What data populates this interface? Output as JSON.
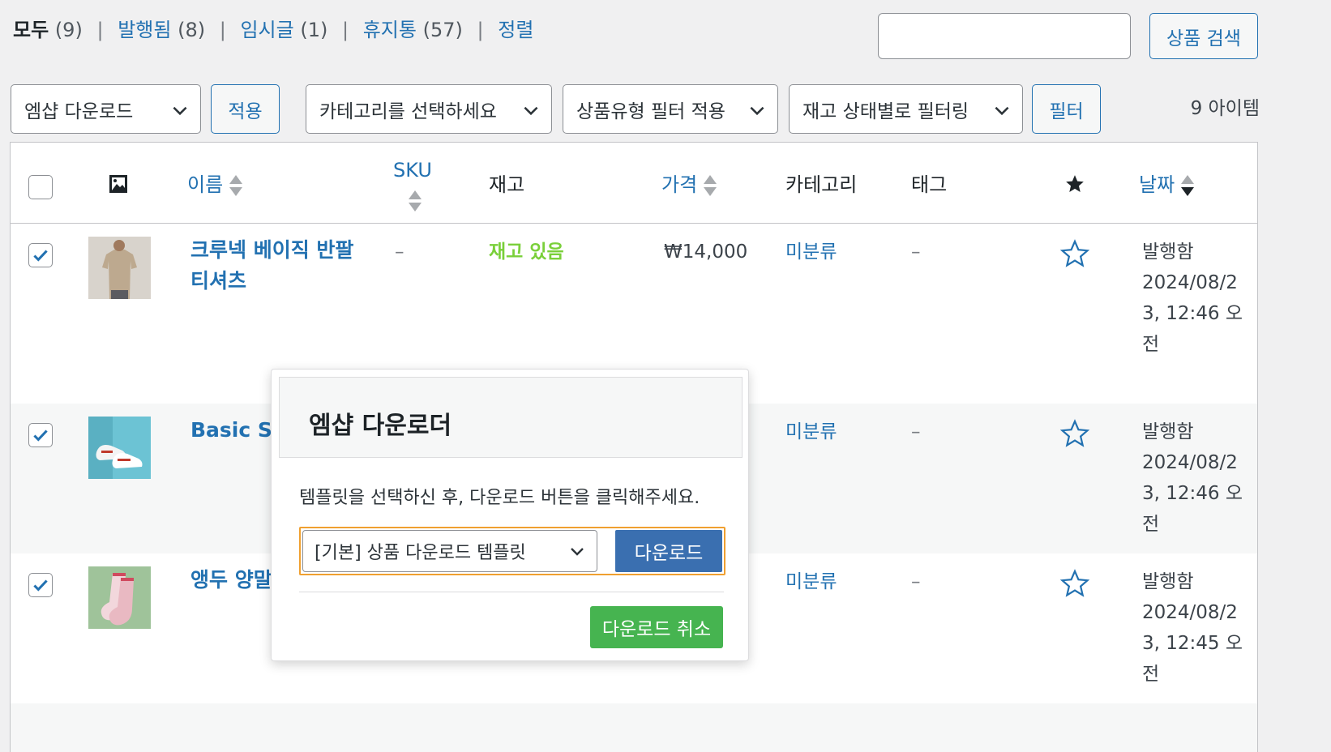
{
  "status_links": {
    "all": {
      "label": "모두",
      "count": "(9)"
    },
    "published": {
      "label": "발행됨",
      "count": "(8)"
    },
    "draft": {
      "label": "임시글",
      "count": "(1)"
    },
    "trash": {
      "label": "휴지통",
      "count": "(57)"
    },
    "sort": {
      "label": "정렬"
    },
    "separator": "|"
  },
  "search": {
    "placeholder": "",
    "button_label": "상품 검색"
  },
  "bulk_action": {
    "selected": "엠샵 다운로드",
    "apply_label": "적용"
  },
  "filters": {
    "category": "카테고리를 선택하세요",
    "product_type": "상품유형 필터 적용",
    "stock_status": "재고 상태별로 필터링",
    "filter_label": "필터"
  },
  "items_count": "9 아이템",
  "table": {
    "headers": {
      "name": "이름",
      "sku": "SKU",
      "stock": "재고",
      "price": "가격",
      "category": "카테고리",
      "tags": "태그",
      "date": "날짜"
    },
    "rows": [
      {
        "name_line1": "크루넥 베이직 반팔",
        "name_line2": "티셔츠",
        "sku": "–",
        "stock": "재고 있음",
        "price": "₩14,000",
        "category": "미분류",
        "tags": "–",
        "date_status": "발행함",
        "date_l1": "2024/08/2",
        "date_l2": "3, 12:46 오",
        "date_l3": "전",
        "checked": true
      },
      {
        "name_line1": "Basic S",
        "category": "미분류",
        "tags": "–",
        "date_status": "발행함",
        "date_l1": "2024/08/2",
        "date_l2": "3, 12:46 오",
        "date_l3": "전",
        "checked": true
      },
      {
        "name_line1": "앵두 양말",
        "category": "미분류",
        "tags": "–",
        "date_status": "발행함",
        "date_l1": "2024/08/2",
        "date_l2": "3, 12:45 오",
        "date_l3": "전",
        "checked": true
      }
    ]
  },
  "modal": {
    "title": "엠샵 다운로더",
    "description": "템플릿을 선택하신 후, 다운로드 버튼을 클릭해주세요.",
    "template_selected": "[기본] 상품 다운로드 템플릿",
    "download_label": "다운로드",
    "cancel_label": "다운로드 취소"
  },
  "colors": {
    "link": "#2271b1",
    "in_stock": "#7ad03a",
    "download_button": "#3a6fb0",
    "cancel_button": "#46b450",
    "focus_outline": "#f0a030"
  }
}
